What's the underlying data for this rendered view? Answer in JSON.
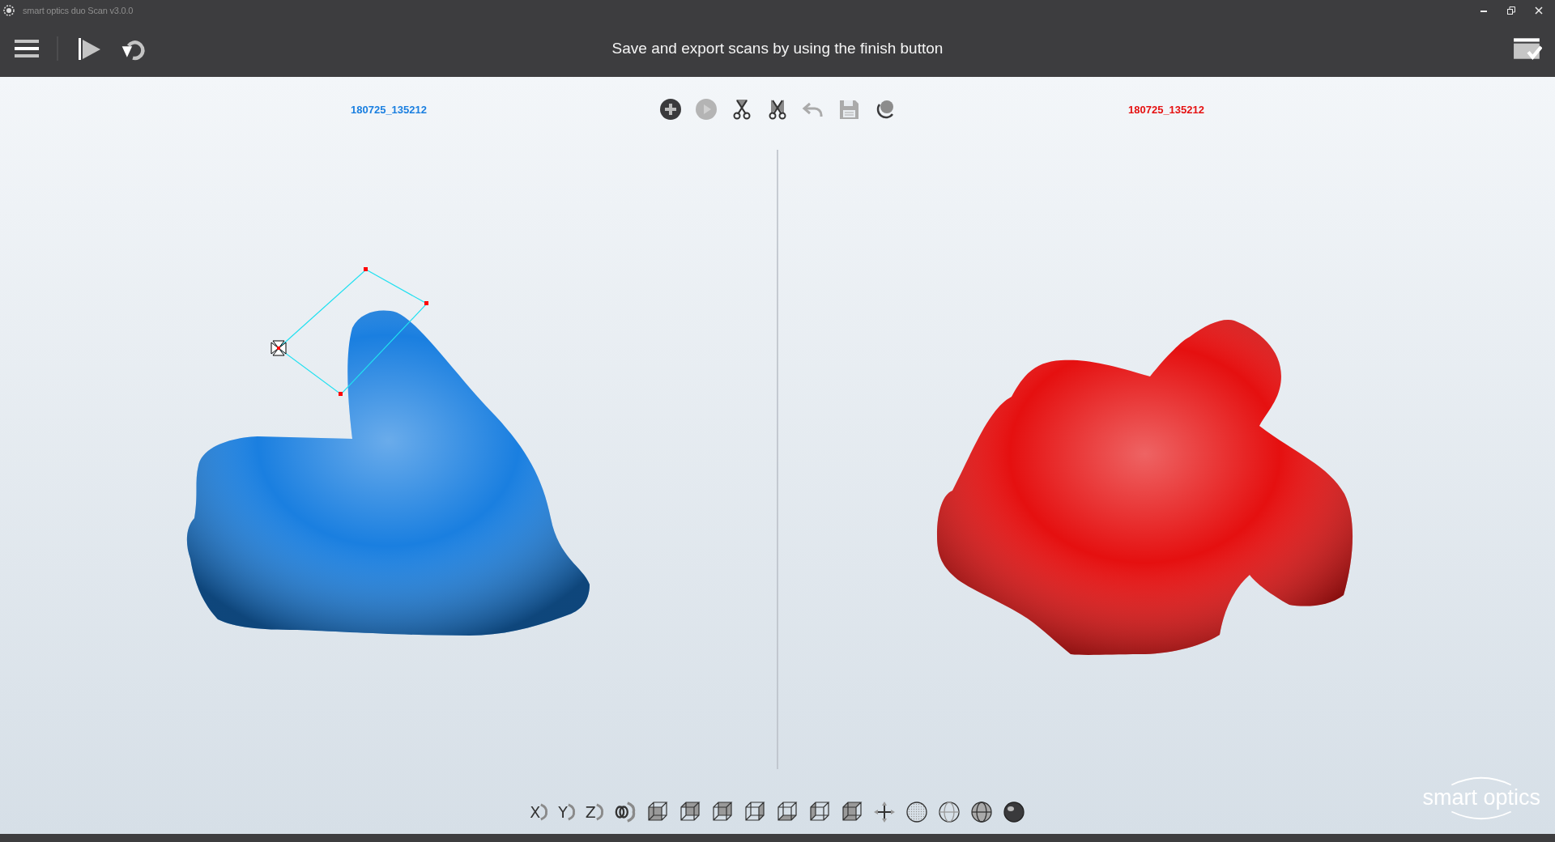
{
  "window": {
    "title": "smart optics duo Scan v3.0.0"
  },
  "header": {
    "message": "Save and export scans by using the finish button"
  },
  "scan_panels": [
    {
      "label": "180725_135212",
      "color": "#1a7fe0"
    },
    {
      "label": "180725_135212",
      "color": "#e51010"
    }
  ],
  "axis_buttons": [
    {
      "label": "X"
    },
    {
      "label": "Y"
    },
    {
      "label": "Z"
    }
  ],
  "logo": {
    "text": "smart optics"
  }
}
